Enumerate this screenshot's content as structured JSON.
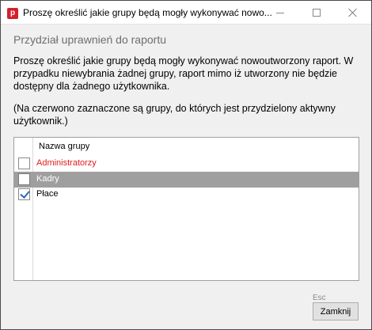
{
  "window": {
    "app_icon_letter": "p",
    "title": "Proszę określić jakie grupy będą mogły wykonywać nowo...",
    "accent_color": "#d4202c"
  },
  "content": {
    "heading": "Przydział uprawnień do raportu",
    "description": "Proszę określić jakie grupy będą mogły wykonywać nowoutworzony raport. W przypadku niewybrania żadnej grupy, raport mimo iż utworzony nie będzie dostępny dla żadnego użytkownika.",
    "note": "(Na czerwono zaznaczone są grupy, do których jest przydzielony aktywny użytkownik.)"
  },
  "grid": {
    "column_header": "Nazwa grupy",
    "rows": [
      {
        "label": "Administratorzy",
        "checked": false,
        "color": "#e11b1b"
      },
      {
        "label": "Kadry",
        "checked": false,
        "selected": true
      },
      {
        "label": "Płace",
        "checked": true
      }
    ]
  },
  "footer": {
    "esc_hint": "Esc",
    "close_label": "Zamknij"
  }
}
